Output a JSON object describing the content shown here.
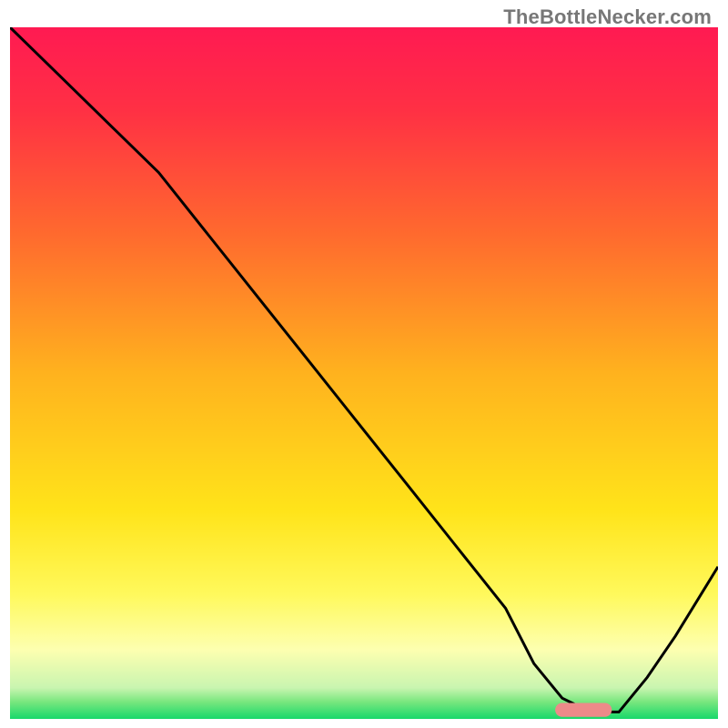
{
  "watermark": "TheBottleNecker.com",
  "chart_data": {
    "type": "line",
    "title": "",
    "xlabel": "",
    "ylabel": "",
    "xlim": [
      0,
      100
    ],
    "ylim": [
      0,
      100
    ],
    "grid": false,
    "background": {
      "type": "vertical-gradient",
      "stops": [
        {
          "pos": 0.0,
          "color": "#ff1a52"
        },
        {
          "pos": 0.12,
          "color": "#ff3044"
        },
        {
          "pos": 0.3,
          "color": "#ff6a2e"
        },
        {
          "pos": 0.5,
          "color": "#ffb21e"
        },
        {
          "pos": 0.7,
          "color": "#ffe41a"
        },
        {
          "pos": 0.82,
          "color": "#fff95c"
        },
        {
          "pos": 0.9,
          "color": "#fdffb0"
        },
        {
          "pos": 0.955,
          "color": "#c9f5b0"
        },
        {
          "pos": 0.975,
          "color": "#7ae77f"
        },
        {
          "pos": 1.0,
          "color": "#18d86a"
        }
      ]
    },
    "series": [
      {
        "name": "bottleneck-curve",
        "stroke": "#000000",
        "stroke_width": 3,
        "x": [
          0,
          7,
          14,
          21,
          28,
          35,
          42,
          49,
          56,
          63,
          70,
          74,
          78,
          82,
          86,
          90,
          94,
          100
        ],
        "y": [
          100,
          93,
          86,
          79,
          70,
          61,
          52,
          43,
          34,
          25,
          16,
          8,
          3,
          1,
          1,
          6,
          12,
          22
        ]
      }
    ],
    "marker": {
      "name": "optimal-range",
      "shape": "capsule",
      "fill": "#ed8a89",
      "x_range": [
        77,
        85
      ],
      "y": 1.3,
      "height_pct": 2.0
    }
  }
}
